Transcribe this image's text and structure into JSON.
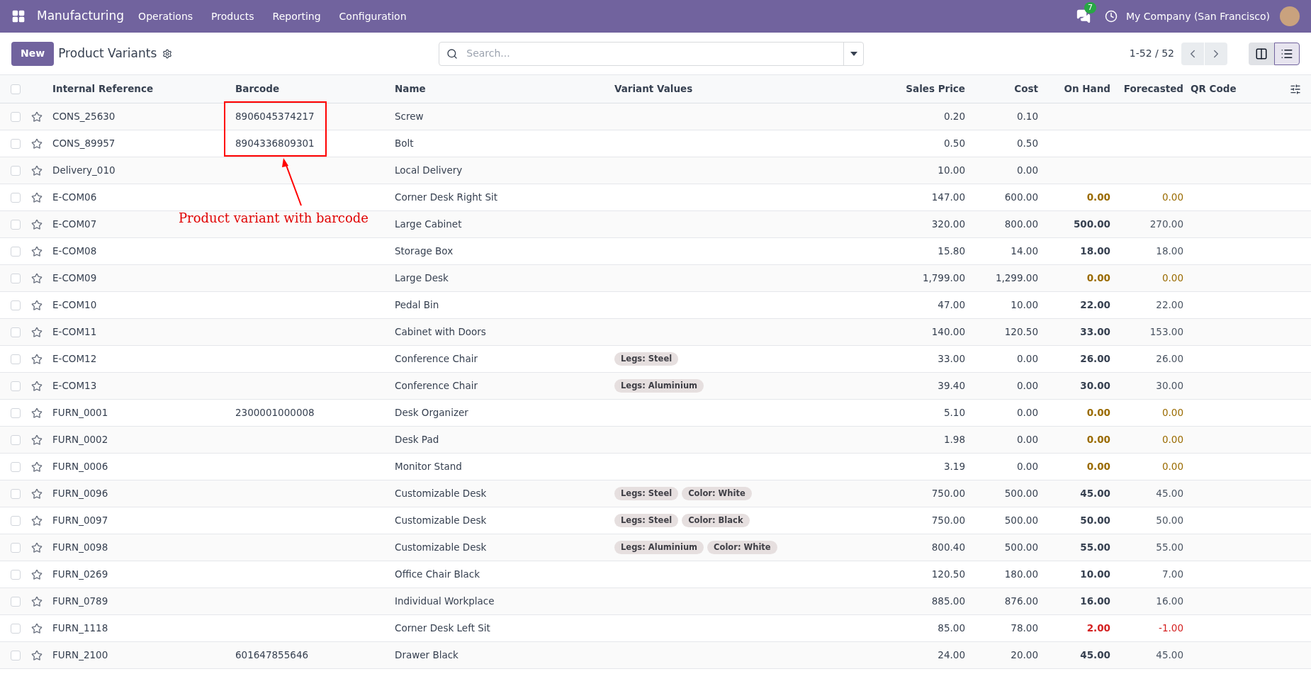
{
  "navbar": {
    "app_name": "Manufacturing",
    "menus": [
      "Operations",
      "Products",
      "Reporting",
      "Configuration"
    ],
    "messages_count": "7",
    "company": "My Company (San Francisco)"
  },
  "control_panel": {
    "new_button": "New",
    "title": "Product Variants",
    "search": {
      "placeholder": "Search..."
    },
    "pager": "1-52 / 52",
    "views": [
      {
        "kind": "kanban",
        "selected": false
      },
      {
        "kind": "list",
        "selected": true
      }
    ]
  },
  "table": {
    "all_checked": false,
    "columns": [
      "Internal Reference",
      "Barcode",
      "Name",
      "Variant Values",
      "Sales Price",
      "Cost",
      "On Hand",
      "Forecasted",
      "QR Code"
    ],
    "rows": [
      {
        "checked": false,
        "ref": "CONS_25630",
        "barcode": "8906045374217",
        "name": "Screw",
        "tags": [],
        "price": "0.20",
        "cost": "0.10"
      },
      {
        "checked": false,
        "ref": "CONS_89957",
        "barcode": "8904336809301",
        "name": "Bolt",
        "tags": [],
        "price": "0.50",
        "cost": "0.50"
      },
      {
        "checked": false,
        "ref": "Delivery_010",
        "name": "Local Delivery",
        "tags": [],
        "price": "10.00",
        "cost": "0.00"
      },
      {
        "checked": false,
        "ref": "E-COM06",
        "name": "Corner Desk Right Sit",
        "tags": [],
        "price": "147.00",
        "cost": "600.00",
        "on_hand": "0.00",
        "forecasted": "0.00",
        "kind": "zero"
      },
      {
        "checked": false,
        "ref": "E-COM07",
        "name": "Large Cabinet",
        "tags": [],
        "price": "320.00",
        "cost": "800.00",
        "on_hand": "500.00",
        "forecasted": "270.00",
        "kind": "ok"
      },
      {
        "checked": false,
        "ref": "E-COM08",
        "name": "Storage Box",
        "tags": [],
        "price": "15.80",
        "cost": "14.00",
        "on_hand": "18.00",
        "forecasted": "18.00",
        "kind": "ok"
      },
      {
        "checked": false,
        "ref": "E-COM09",
        "name": "Large Desk",
        "tags": [],
        "price": "1,799.00",
        "cost": "1,299.00",
        "on_hand": "0.00",
        "forecasted": "0.00",
        "kind": "zero"
      },
      {
        "checked": false,
        "ref": "E-COM10",
        "name": "Pedal Bin",
        "tags": [],
        "price": "47.00",
        "cost": "10.00",
        "on_hand": "22.00",
        "forecasted": "22.00",
        "kind": "ok"
      },
      {
        "checked": false,
        "ref": "E-COM11",
        "name": "Cabinet with Doors",
        "tags": [],
        "price": "140.00",
        "cost": "120.50",
        "on_hand": "33.00",
        "forecasted": "153.00",
        "kind": "ok"
      },
      {
        "checked": false,
        "ref": "E-COM12",
        "name": "Conference Chair",
        "tags": [
          "Legs: Steel"
        ],
        "price": "33.00",
        "cost": "0.00",
        "on_hand": "26.00",
        "forecasted": "26.00",
        "kind": "ok"
      },
      {
        "checked": false,
        "ref": "E-COM13",
        "name": "Conference Chair",
        "tags": [
          "Legs: Aluminium"
        ],
        "price": "39.40",
        "cost": "0.00",
        "on_hand": "30.00",
        "forecasted": "30.00",
        "kind": "ok"
      },
      {
        "checked": false,
        "ref": "FURN_0001",
        "barcode": "2300001000008",
        "name": "Desk Organizer",
        "tags": [],
        "price": "5.10",
        "cost": "0.00",
        "on_hand": "0.00",
        "forecasted": "0.00",
        "kind": "zero"
      },
      {
        "checked": false,
        "ref": "FURN_0002",
        "name": "Desk Pad",
        "tags": [],
        "price": "1.98",
        "cost": "0.00",
        "on_hand": "0.00",
        "forecasted": "0.00",
        "kind": "zero"
      },
      {
        "checked": false,
        "ref": "FURN_0006",
        "name": "Monitor Stand",
        "tags": [],
        "price": "3.19",
        "cost": "0.00",
        "on_hand": "0.00",
        "forecasted": "0.00",
        "kind": "zero"
      },
      {
        "checked": false,
        "ref": "FURN_0096",
        "name": "Customizable Desk",
        "tags": [
          "Legs: Steel",
          "Color: White"
        ],
        "price": "750.00",
        "cost": "500.00",
        "on_hand": "45.00",
        "forecasted": "45.00",
        "kind": "ok"
      },
      {
        "checked": false,
        "ref": "FURN_0097",
        "name": "Customizable Desk",
        "tags": [
          "Legs: Steel",
          "Color: Black"
        ],
        "price": "750.00",
        "cost": "500.00",
        "on_hand": "50.00",
        "forecasted": "50.00",
        "kind": "ok"
      },
      {
        "checked": false,
        "ref": "FURN_0098",
        "name": "Customizable Desk",
        "tags": [
          "Legs: Aluminium",
          "Color: White"
        ],
        "price": "800.40",
        "cost": "500.00",
        "on_hand": "55.00",
        "forecasted": "55.00",
        "kind": "ok"
      },
      {
        "checked": false,
        "ref": "FURN_0269",
        "name": "Office Chair Black",
        "tags": [],
        "price": "120.50",
        "cost": "180.00",
        "on_hand": "10.00",
        "forecasted": "7.00",
        "kind": "ok"
      },
      {
        "checked": false,
        "ref": "FURN_0789",
        "name": "Individual Workplace",
        "tags": [],
        "price": "885.00",
        "cost": "876.00",
        "on_hand": "16.00",
        "forecasted": "16.00",
        "kind": "ok"
      },
      {
        "checked": false,
        "ref": "FURN_1118",
        "name": "Corner Desk Left Sit",
        "tags": [],
        "price": "85.00",
        "cost": "78.00",
        "on_hand": "2.00",
        "forecasted": "-1.00",
        "kind": "negative"
      },
      {
        "checked": false,
        "ref": "FURN_2100",
        "barcode": "601647855646",
        "name": "Drawer Black",
        "tags": [],
        "price": "24.00",
        "cost": "20.00",
        "on_hand": "45.00",
        "forecasted": "45.00",
        "kind": "ok"
      }
    ]
  },
  "annotation": {
    "text": "Product variant with barcode"
  }
}
